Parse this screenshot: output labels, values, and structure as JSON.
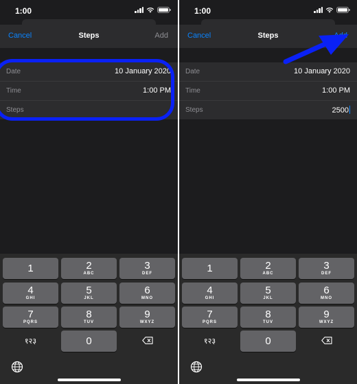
{
  "screens": [
    {
      "status": {
        "time": "1:00"
      },
      "navbar": {
        "cancel_label": "Cancel",
        "title": "Steps",
        "add_label": "Add"
      },
      "form": {
        "date_label": "Date",
        "date_value": "10 January 2020",
        "time_label": "Time",
        "time_value": "1:00 PM",
        "steps_label": "Steps",
        "steps_value": ""
      }
    },
    {
      "status": {
        "time": "1:00"
      },
      "navbar": {
        "cancel_label": "Cancel",
        "title": "Steps",
        "add_label": "Add"
      },
      "form": {
        "date_label": "Date",
        "date_value": "10 January 2020",
        "time_label": "Time",
        "time_value": "1:00 PM",
        "steps_label": "Steps",
        "steps_value": "2500"
      }
    }
  ],
  "keypad": {
    "keys": [
      {
        "digit": "1",
        "letters": ""
      },
      {
        "digit": "2",
        "letters": "ABC"
      },
      {
        "digit": "3",
        "letters": "DEF"
      },
      {
        "digit": "4",
        "letters": "GHI"
      },
      {
        "digit": "5",
        "letters": "JKL"
      },
      {
        "digit": "6",
        "letters": "MNO"
      },
      {
        "digit": "7",
        "letters": "PQRS"
      },
      {
        "digit": "8",
        "letters": "TUV"
      },
      {
        "digit": "9",
        "letters": "WXYZ"
      }
    ],
    "zero": "0",
    "alt_numerals": "१२३",
    "delete_icon": "backspace-icon",
    "globe_icon": "globe-icon"
  },
  "annotation": {
    "ring_color": "#0a21f5",
    "arrow_color": "#0a21f5"
  },
  "colors": {
    "accent": "#0a84ff",
    "background": "#1c1c1e",
    "cell": "#2c2c2e",
    "key": "#636366"
  }
}
